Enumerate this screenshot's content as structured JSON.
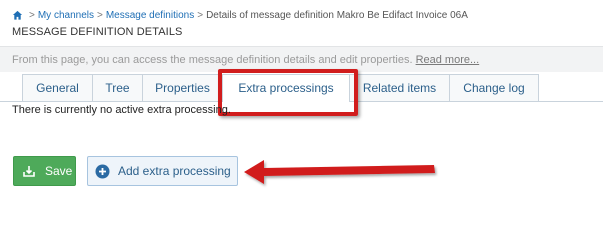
{
  "breadcrumb": {
    "home_icon": "home-icon",
    "separator": ">",
    "link1": "My channels",
    "link2": "Message definitions",
    "current": "Details of message definition Makro Be Edifact Invoice 06A"
  },
  "page_title": "MESSAGE DEFINITION DETAILS",
  "info": {
    "text": "From this page, you can access the message definition details and edit properties.",
    "read_more": "Read more..."
  },
  "tabs": [
    {
      "label": "General"
    },
    {
      "label": "Tree"
    },
    {
      "label": "Properties"
    },
    {
      "label": "Extra processings"
    },
    {
      "label": "Related items"
    },
    {
      "label": "Change log"
    }
  ],
  "active_tab": "Extra processings",
  "empty_message": "There is currently no active extra processing.",
  "buttons": {
    "save_label": "Save",
    "save_icon": "save-icon",
    "add_label": "Add extra processing",
    "add_icon": "plus-circle-icon"
  },
  "colors": {
    "link": "#1f6fb5",
    "save_button": "#4eaa5a",
    "annotation_red": "#d11d1d"
  }
}
